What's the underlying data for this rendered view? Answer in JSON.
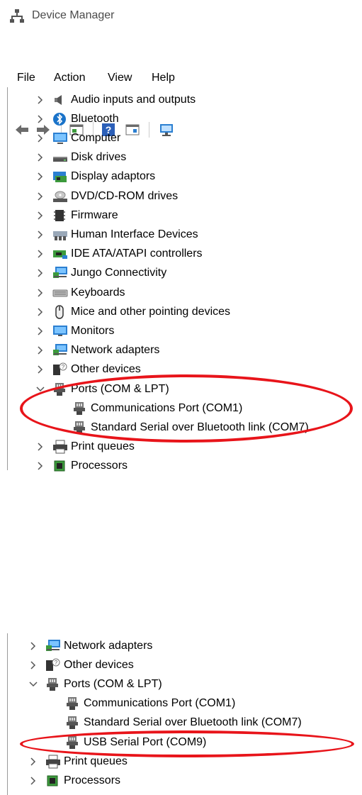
{
  "window": {
    "title": "Device Manager"
  },
  "menu": {
    "file": "File",
    "action": "Action",
    "view": "View",
    "help": "Help"
  },
  "toolbar": {
    "icons": [
      "back-arrow-icon",
      "forward-arrow-icon",
      "properties-icon",
      "help-icon",
      "update-driver-icon",
      "scan-hardware-icon"
    ]
  },
  "tree_top": {
    "categories": [
      {
        "label": "Audio inputs and outputs",
        "icon": "speaker-icon"
      },
      {
        "label": "Bluetooth",
        "icon": "bluetooth-icon"
      },
      {
        "label": "Computer",
        "icon": "computer-icon"
      },
      {
        "label": "Disk drives",
        "icon": "disk-drive-icon"
      },
      {
        "label": "Display adaptors",
        "icon": "display-adapter-icon"
      },
      {
        "label": "DVD/CD-ROM drives",
        "icon": "dvd-drive-icon"
      },
      {
        "label": "Firmware",
        "icon": "firmware-icon"
      },
      {
        "label": "Human Interface Devices",
        "icon": "hid-icon"
      },
      {
        "label": "IDE ATA/ATAPI controllers",
        "icon": "ide-controller-icon"
      },
      {
        "label": "Jungo Connectivity",
        "icon": "network-icon"
      },
      {
        "label": "Keyboards",
        "icon": "keyboard-icon"
      },
      {
        "label": "Mice and other pointing devices",
        "icon": "mouse-icon"
      },
      {
        "label": "Monitors",
        "icon": "monitor-icon"
      },
      {
        "label": "Network adapters",
        "icon": "network-icon"
      },
      {
        "label": "Other devices",
        "icon": "unknown-device-icon"
      },
      {
        "label": "Ports (COM & LPT)",
        "icon": "port-icon"
      },
      {
        "label": "Communications Port (COM1)",
        "icon": "port-icon"
      },
      {
        "label": "Standard Serial over Bluetooth link (COM7)",
        "icon": "port-icon"
      },
      {
        "label": "Print queues",
        "icon": "printer-icon"
      },
      {
        "label": "Processors",
        "icon": "processor-icon"
      }
    ]
  },
  "tree_bottom": {
    "items": [
      {
        "label": "Network adapters",
        "icon": "network-icon"
      },
      {
        "label": "Other devices",
        "icon": "unknown-device-icon"
      },
      {
        "label": "Ports (COM & LPT)",
        "icon": "port-icon"
      },
      {
        "label": "Communications Port (COM1)",
        "icon": "port-icon"
      },
      {
        "label": "Standard Serial over Bluetooth link (COM7)",
        "icon": "port-icon"
      },
      {
        "label": "USB Serial Port (COM9)",
        "icon": "port-icon"
      },
      {
        "label": "Print queues",
        "icon": "printer-icon"
      },
      {
        "label": "Processors",
        "icon": "processor-icon"
      }
    ]
  },
  "colors": {
    "highlight": "#e8141a",
    "accent": "#2b7fd1"
  }
}
